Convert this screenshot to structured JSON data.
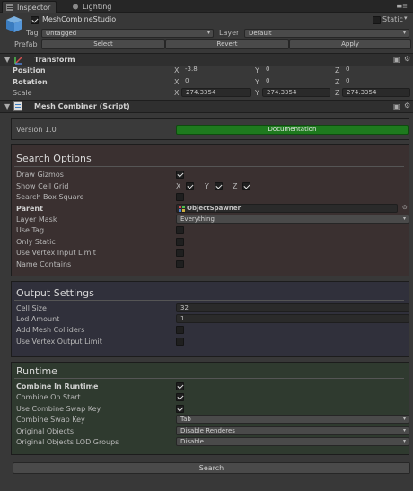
{
  "tabs": [
    {
      "label": "Inspector",
      "icon": "inspector-icon"
    },
    {
      "label": "Lighting",
      "icon": "lighting-icon"
    }
  ],
  "object": {
    "name": "MeshCombineStudio",
    "active": true,
    "static_label": "Static",
    "tag_label": "Tag",
    "tag_value": "Untagged",
    "layer_label": "Layer",
    "layer_value": "Default",
    "prefab_label": "Prefab",
    "prefab_buttons": [
      "Select",
      "Revert",
      "Apply"
    ]
  },
  "transform": {
    "title": "Transform",
    "rows": [
      {
        "label": "Position",
        "x": "-3.8",
        "y": "0",
        "z": "0",
        "bold": true
      },
      {
        "label": "Rotation",
        "x": "0",
        "y": "0",
        "z": "0",
        "bold": true
      },
      {
        "label": "Scale",
        "x": "274.3354",
        "y": "274.3354",
        "z": "274.3354",
        "bold": false
      }
    ],
    "axis_labels": [
      "X",
      "Y",
      "Z"
    ]
  },
  "script": {
    "title": "Mesh Combiner (Script)",
    "version": "Version 1.0",
    "doc_button": "Documentation"
  },
  "search_options": {
    "title": "Search Options",
    "draw_gizmos": {
      "label": "Draw Gizmos",
      "checked": true
    },
    "show_cell_grid": {
      "label": "Show Cell Grid",
      "x": true,
      "y": true,
      "z": true
    },
    "search_box_square": {
      "label": "Search Box Square",
      "checked": false
    },
    "parent": {
      "label": "Parent",
      "value": "ObjectSpawner"
    },
    "layer_mask": {
      "label": "Layer Mask",
      "value": "Everything"
    },
    "use_tag": {
      "label": "Use Tag",
      "checked": false
    },
    "only_static": {
      "label": "Only Static",
      "checked": false
    },
    "use_vertex_input_limit": {
      "label": "Use Vertex Input Limit",
      "checked": false
    },
    "name_contains": {
      "label": "Name Contains",
      "checked": false
    }
  },
  "output_settings": {
    "title": "Output Settings",
    "cell_size": {
      "label": "Cell Size",
      "value": "32"
    },
    "lod_amount": {
      "label": "Lod Amount",
      "value": "1"
    },
    "add_mesh_colliders": {
      "label": "Add Mesh Colliders",
      "checked": false
    },
    "use_vertex_output_limit": {
      "label": "Use Vertex Output Limit",
      "checked": false
    }
  },
  "runtime": {
    "title": "Runtime",
    "combine_in_runtime": {
      "label": "Combine In Runtime",
      "checked": true
    },
    "combine_on_start": {
      "label": "Combine On Start",
      "checked": true
    },
    "use_combine_swap_key": {
      "label": "Use Combine Swap Key",
      "checked": true
    },
    "combine_swap_key": {
      "label": "Combine Swap Key",
      "value": "Tab"
    },
    "original_objects": {
      "label": "Original Objects",
      "value": "Disable Renderes"
    },
    "original_objects_lod": {
      "label": "Original Objects LOD Groups",
      "value": "Disable"
    }
  },
  "search_button": "Search",
  "colors": {
    "search_bg": "#3a3030",
    "output_bg": "#30303b",
    "runtime_bg": "#2f3a2f",
    "doc_button": "#1e7a1e"
  }
}
